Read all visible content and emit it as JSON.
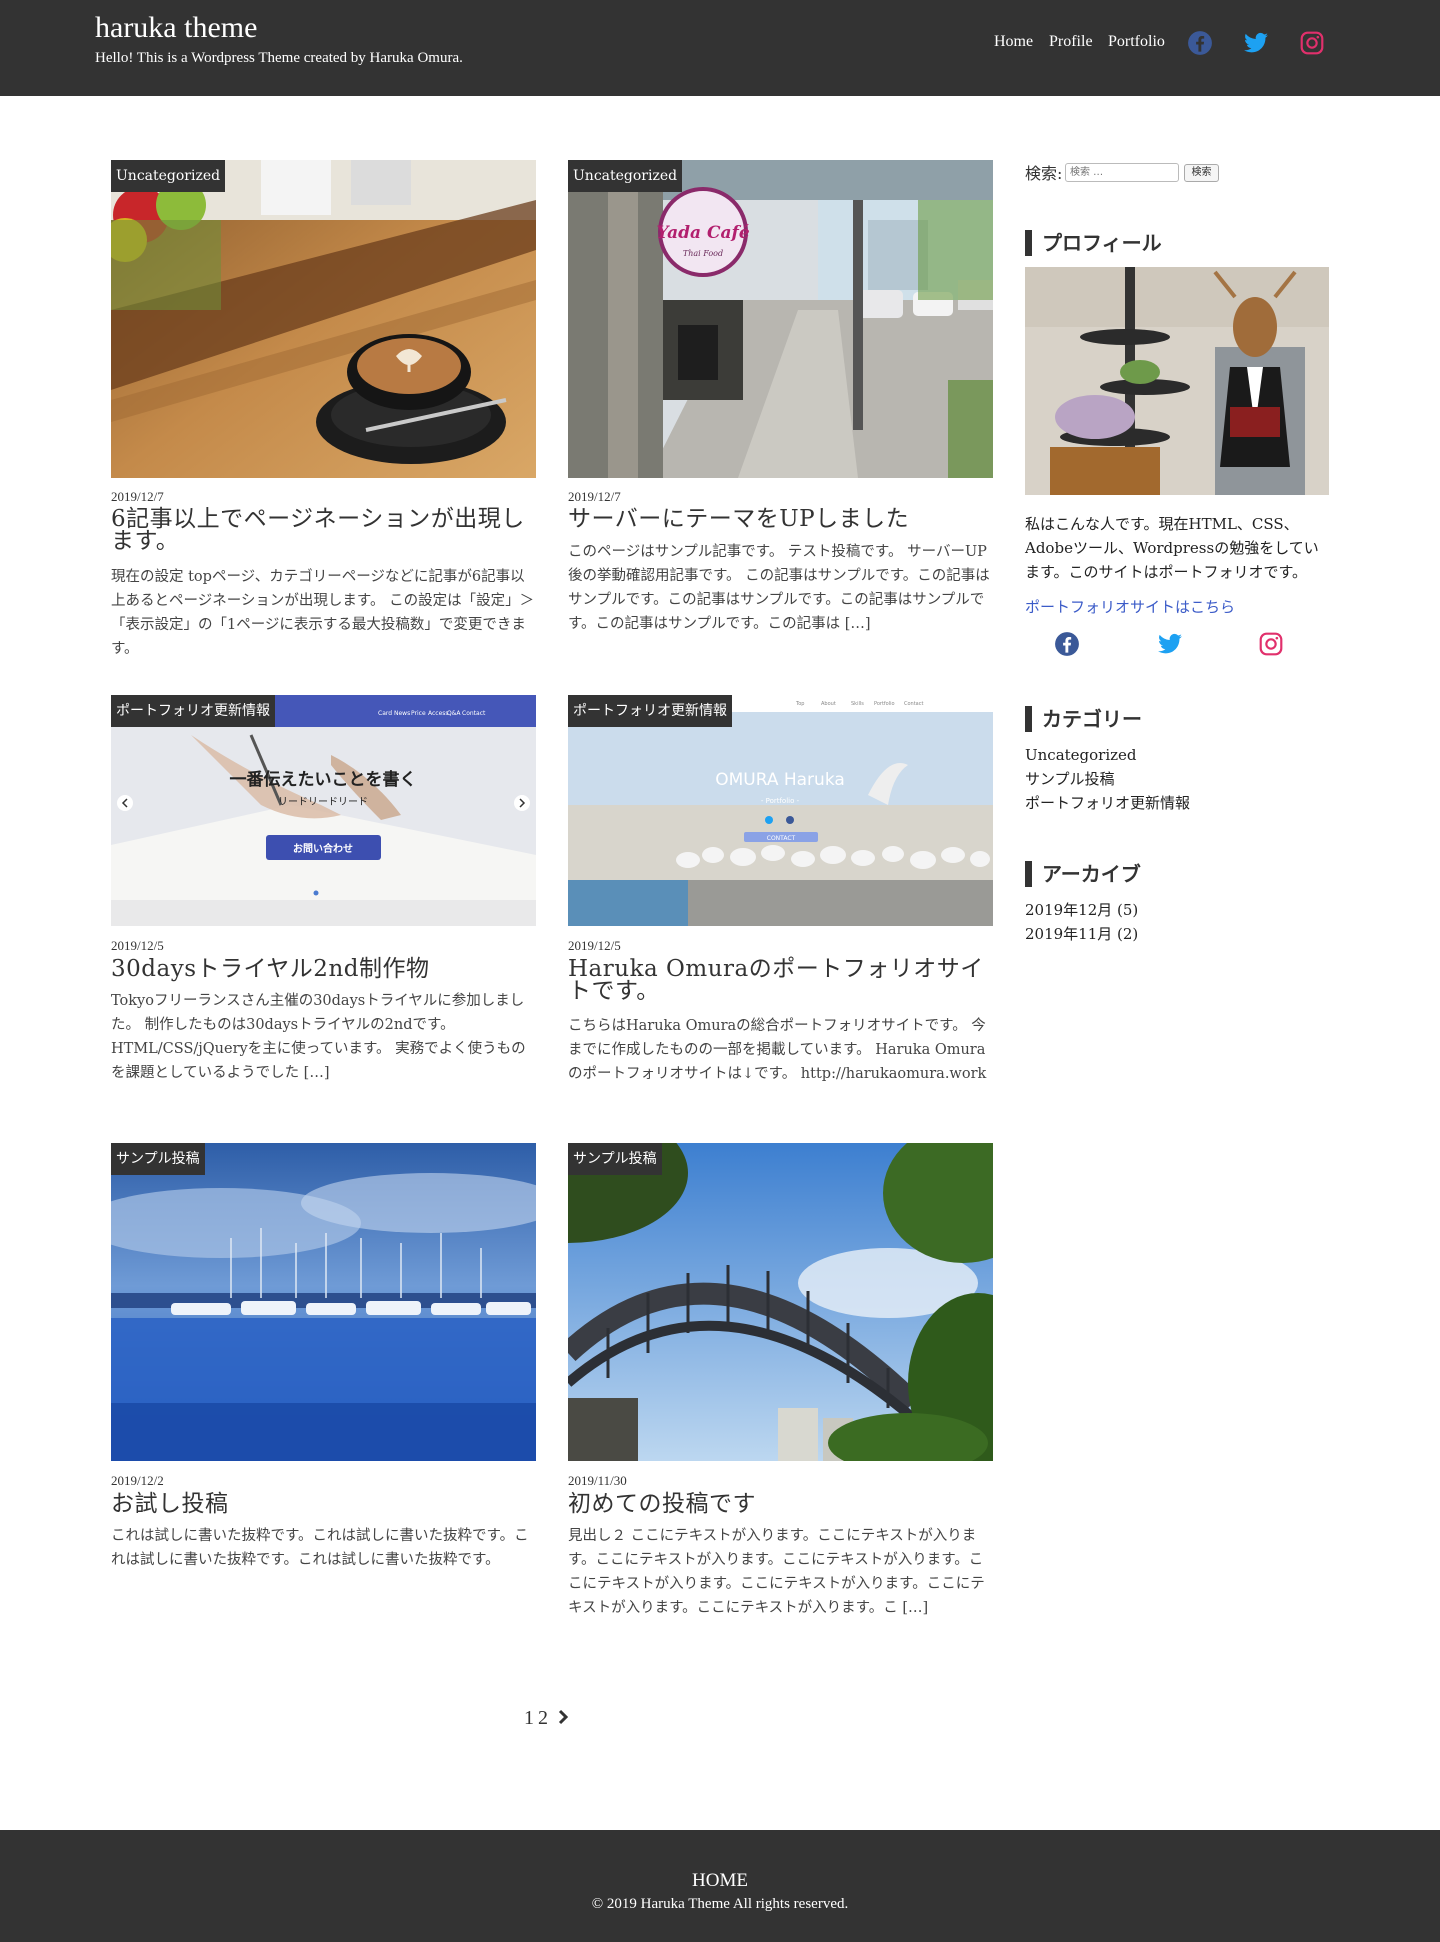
{
  "header": {
    "title": "haruka theme",
    "description": "Hello! This is a Wordpress Theme created by Haruka Omura.",
    "nav": [
      "Home",
      "Profile",
      "Portfolio"
    ],
    "social_icons": [
      "facebook-icon",
      "twitter-icon",
      "instagram-icon"
    ]
  },
  "posts": [
    {
      "category": "Uncategorized",
      "date": "2019/12/7",
      "title": "6記事以上でページネーションが出現します。",
      "excerpt": "現在の設定 topページ、カテゴリーページなどに記事が6記事以上あるとページネーションが出現します。 この設定は「設定」＞「表示設定」の「1ページに表示する最大投稿数」で変更できます。"
    },
    {
      "category": "Uncategorized",
      "date": "2019/12/7",
      "title": "サーバーにテーマをUPしました",
      "excerpt": "このページはサンプル記事です。 テスト投稿です。 サーバーUP後の挙動確認用記事です。 この記事はサンプルです。この記事はサンプルです。この記事はサンプルです。この記事はサンプルです。この記事はサンプルです。この記事は […]"
    },
    {
      "category": "ポートフォリオ更新情報",
      "date": "2019/12/5",
      "title": "30daysトライヤル2nd制作物",
      "excerpt": "Tokyoフリーランスさん主催の30daysトライヤルに参加しました。 制作したものは30daysトライヤルの2ndです。 HTML/CSS/jQueryを主に使っています。 実務でよく使うものを課題としているようでした […]"
    },
    {
      "category": "ポートフォリオ更新情報",
      "date": "2019/12/5",
      "title": "Haruka Omuraのポートフォリオサイトです。",
      "excerpt": "こちらはHaruka Omuraの総合ポートフォリオサイトです。 今までに作成したものの一部を掲載しています。 Haruka Omuraのポートフォリオサイトは↓です。 http://harukaomura.work"
    },
    {
      "category": "サンプル投稿",
      "date": "2019/12/2",
      "title": "お試し投稿",
      "excerpt": "これは試しに書いた抜粋です。これは試しに書いた抜粋です。これは試しに書いた抜粋です。これは試しに書いた抜粋です。"
    },
    {
      "category": "サンプル投稿",
      "date": "2019/11/30",
      "title": "初めての投稿です",
      "excerpt": "見出し２ ここにテキストが入ります。ここにテキストが入ります。ここにテキストが入ります。ここにテキストが入ります。ここにテキストが入ります。ここにテキストが入ります。ここにテキストが入ります。ここにテキストが入ります。こ […]"
    }
  ],
  "thumb_texts": {
    "lp": {
      "nav": [
        "Card",
        "News",
        "Price",
        "Access",
        "Q&A",
        "Contact"
      ],
      "headline": "一番伝えたいことを書く",
      "sub": "リードリードリード",
      "button": "お問い合わせ"
    },
    "portfolio": {
      "nav": [
        "Top",
        "About",
        "Skills",
        "Portfolio",
        "Contact"
      ],
      "name": "OMURA Haruka",
      "sub": "- Portfolio -",
      "button": "CONTACT"
    },
    "cafe_sign": {
      "name": "Yada Café",
      "sub": "Thai Food"
    }
  },
  "sidebar": {
    "search_label": "検索:",
    "search_placeholder": "検索 …",
    "search_button": "検索",
    "profile_title": "プロフィール",
    "profile_text": "私はこんな人です。現在HTML、CSS、Adobeツール、Wordpressの勉強をしています。このサイトはポートフォリオです。",
    "profile_link": "ポートフォリオサイトはこちら",
    "category_title": "カテゴリー",
    "categories": [
      "Uncategorized",
      "サンプル投稿",
      "ポートフォリオ更新情報"
    ],
    "archive_title": "アーカイブ",
    "archives": [
      "2019年12月 (5)",
      "2019年11月 (2)"
    ]
  },
  "pagination": {
    "pages": [
      "1",
      "2"
    ],
    "next": "›"
  },
  "footer": {
    "home": "HOME",
    "copyright": "© 2019 Haruka Theme All rights reserved."
  },
  "colors": {
    "header_bg": "#333333",
    "facebook": "#3b5998",
    "twitter": "#1da1f2",
    "instagram": "#e1306c",
    "link": "#3b5bc8"
  }
}
